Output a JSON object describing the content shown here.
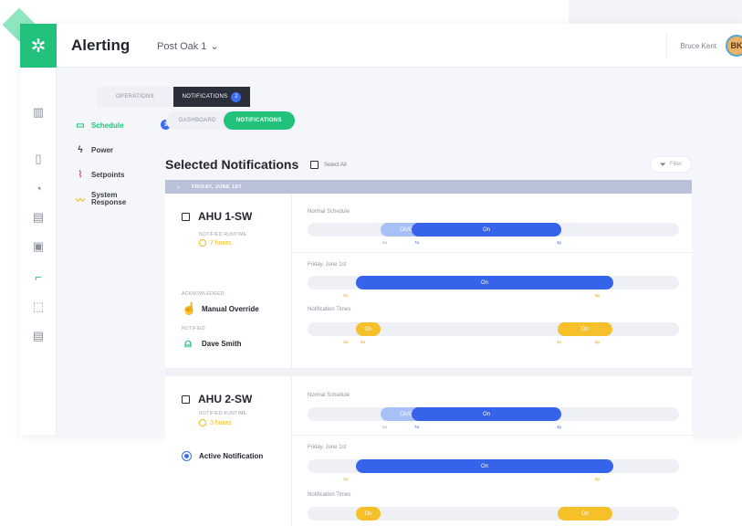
{
  "header": {
    "app_title": "Alerting",
    "site": "Post Oak 1",
    "user_name": "Bruce Kent",
    "avatar_initials": "BK"
  },
  "top_tabs": [
    {
      "label": "OPERATIONS",
      "badge": ""
    },
    {
      "label": "NOTIFICATIONS",
      "badge": "2"
    }
  ],
  "left_menu": [
    {
      "label": "Schedule",
      "badge": "3",
      "icon": "calendar-icon"
    },
    {
      "label": "Power",
      "icon": "lightning-icon"
    },
    {
      "label": "Setpoints",
      "icon": "thermometer-icon"
    },
    {
      "label": "System Response",
      "icon": "pulse-icon"
    }
  ],
  "sub_tabs": [
    "DASHBOARD",
    "NOTIFICATIONS"
  ],
  "main": {
    "section_title": "Selected Notifications",
    "select_all": "Select All",
    "filter": "Filter",
    "date_header": "FRIDAY, JUNE 1ST"
  },
  "cards": [
    {
      "unit": "AHU 1-SW",
      "runtime_label": "NOTIFIED RUNTIME",
      "runtime_value": "7 hours",
      "ack_label": "ACKNOWLEDGED",
      "ack_value": "Manual Override",
      "notified_label": "NOTIFIED",
      "notified_value": "Dave Smith",
      "normal_label": "Normal Schedule",
      "normal_onoff": "On/Off",
      "normal_on": "On",
      "normal_ticks": [
        "5a",
        "7a",
        "4p"
      ],
      "day_label": "Friday, June 1st",
      "day_on": "On",
      "day_ticks": [
        "3a",
        "8p"
      ],
      "notif_label": "Notification Times",
      "notif_on": [
        "On",
        "On"
      ],
      "notif_ticks": [
        "3a",
        "5a",
        "4p",
        "8p"
      ]
    },
    {
      "unit": "AHU 2-SW",
      "runtime_label": "NOTIFIED RUNTIME",
      "runtime_value": "3 hours",
      "active_label": "Active Notification",
      "normal_label": "Normal Schedule",
      "normal_onoff": "On/Off",
      "normal_on": "On",
      "normal_ticks": [
        "5a",
        "7a",
        "4p"
      ],
      "day_label": "Friday, June 1st",
      "day_on": "On",
      "day_ticks": [
        "3a",
        "8p"
      ],
      "notif_label": "Notification Times",
      "notif_on": [
        "On",
        "On"
      ]
    }
  ],
  "colors": {
    "accent_green": "#22c27d",
    "schedule_blue": "#3563e9",
    "light_blue": "#a8c0f6",
    "notify_yellow": "#f6c02a",
    "date_bar": "#b9c2d9"
  }
}
